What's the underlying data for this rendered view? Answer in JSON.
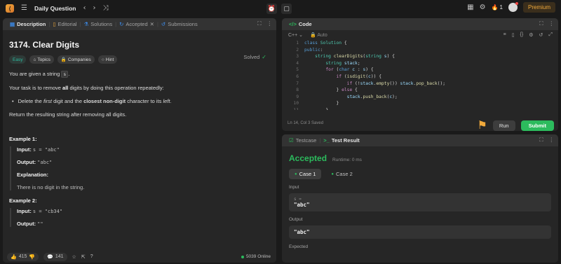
{
  "topbar": {
    "title": "Daily Question",
    "streak": "1",
    "premium": "Premium"
  },
  "left_tabs": [
    "Description",
    "Editorial",
    "Solutions",
    "Accepted",
    "Submissions"
  ],
  "problem": {
    "title": "3174. Clear Digits",
    "solved": "Solved",
    "chips": [
      "Easy",
      "Topics",
      "Companies",
      "Hint"
    ],
    "p1_prefix": "You are given a string",
    "p1_code": "s",
    "p1_suffix": ".",
    "p2_a": "Your task is to remove",
    "p2_b": "all",
    "p2_c": "digits by doing this operation repeatedly:",
    "b_a": "Delete the",
    "b_b": "first",
    "b_c": "digit and the",
    "b_d": "closest non-digit",
    "b_e": "character to its",
    "b_f": "left",
    "b_g": ".",
    "p3": "Return the resulting string after removing all digits."
  },
  "examples": [
    {
      "title": "Example 1:",
      "input_label": "Input:",
      "input_value": "s = \"abc\"",
      "output_label": "Output:",
      "output_value": "\"abc\"",
      "explanation_label": "Explanation:",
      "explanation": "There is no digit in the string."
    },
    {
      "title": "Example 2:",
      "input_label": "Input:",
      "input_value": "s = \"cb34\"",
      "output_label": "Output:",
      "output_value": "\"\""
    }
  ],
  "footer": {
    "likes": "415",
    "comments": "141",
    "online": "5039 Online"
  },
  "code_panel": {
    "tab": "Code",
    "language": "C++",
    "mode": "Auto",
    "line_numbers": [
      "1",
      "2",
      "3",
      "4",
      "5",
      "6",
      "7",
      "8",
      "9",
      "10",
      "11"
    ],
    "status": "Ln 14, Col 3   Saved",
    "run": "Run",
    "submit": "Submit"
  },
  "test_panel": {
    "tabs": [
      "Testcase",
      "Test Result"
    ],
    "result": "Accepted",
    "runtime": "Runtime: 0 ms",
    "cases": [
      "Case 1",
      "Case 2"
    ],
    "input_label": "Input",
    "input_var": "s =",
    "input_value": "\"abc\"",
    "output_label": "Output",
    "output_value": "\"abc\"",
    "expected_label": "Expected"
  },
  "colors": {
    "accent_green": "#2cbb5d",
    "accent_orange": "#f0a93b",
    "panel_bg": "#262626"
  },
  "icons": [
    "menu-icon",
    "chevron-left-icon",
    "chevron-right-icon",
    "shuffle-icon",
    "alarm-icon",
    "notes-icon",
    "grid-icon",
    "gear-icon",
    "fire-icon"
  ]
}
